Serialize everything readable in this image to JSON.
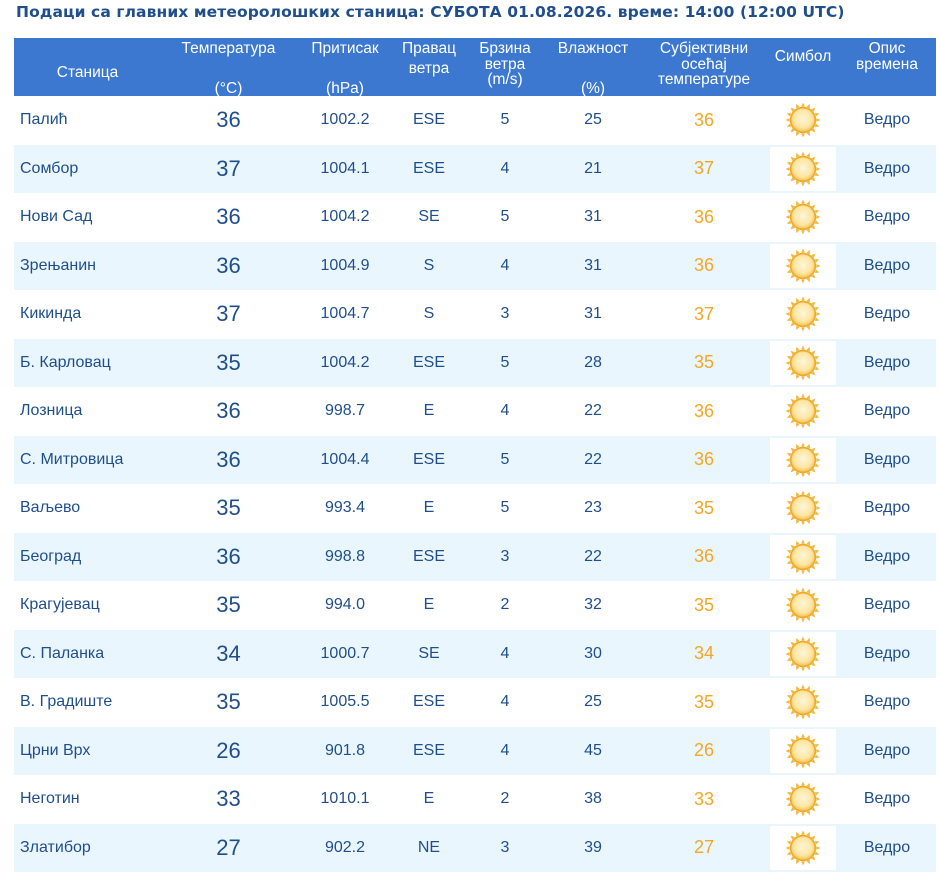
{
  "title": "Подаци са главних метеоролошких станица:  СУБОТА 01.08.2026.  време: 14:00 (12:00 UTC)",
  "headers": {
    "station": "Станица",
    "temperature": [
      "Температура",
      "(°C)"
    ],
    "pressure": [
      "Притисак",
      "(hPa)"
    ],
    "wind_dir": [
      "Правац",
      "ветра"
    ],
    "wind_speed": [
      "Брзина",
      "ветра",
      "(m/s)"
    ],
    "humidity": [
      "Влажност",
      "(%)"
    ],
    "feels_like": [
      "Субјективни",
      "осећај",
      "температуре"
    ],
    "symbol": "Симбол",
    "description": [
      "Опис",
      "времена"
    ]
  },
  "symbol_icon": "sun-icon",
  "colors": {
    "header_bg": "#3c78d0",
    "text": "#1f4e8c",
    "feels_like": "#f5a623",
    "row_alt": "#eaf6fd"
  },
  "rows": [
    {
      "station": "Палић",
      "temp": "36",
      "pressure": "1002.2",
      "dir": "ESE",
      "speed": "5",
      "humidity": "25",
      "feels": "36",
      "desc": "Ведро"
    },
    {
      "station": "Сомбор",
      "temp": "37",
      "pressure": "1004.1",
      "dir": "ESE",
      "speed": "4",
      "humidity": "21",
      "feels": "37",
      "desc": "Ведро"
    },
    {
      "station": "Нови Сад",
      "temp": "36",
      "pressure": "1004.2",
      "dir": "SE",
      "speed": "5",
      "humidity": "31",
      "feels": "36",
      "desc": "Ведро"
    },
    {
      "station": "Зрењанин",
      "temp": "36",
      "pressure": "1004.9",
      "dir": "S",
      "speed": "4",
      "humidity": "31",
      "feels": "36",
      "desc": "Ведро"
    },
    {
      "station": "Кикинда",
      "temp": "37",
      "pressure": "1004.7",
      "dir": "S",
      "speed": "3",
      "humidity": "31",
      "feels": "37",
      "desc": "Ведро"
    },
    {
      "station": "Б. Карловац",
      "temp": "35",
      "pressure": "1004.2",
      "dir": "ESE",
      "speed": "5",
      "humidity": "28",
      "feels": "35",
      "desc": "Ведро"
    },
    {
      "station": "Лозница",
      "temp": "36",
      "pressure": "998.7",
      "dir": "E",
      "speed": "4",
      "humidity": "22",
      "feels": "36",
      "desc": "Ведро"
    },
    {
      "station": "С. Митровица",
      "temp": "36",
      "pressure": "1004.4",
      "dir": "ESE",
      "speed": "5",
      "humidity": "22",
      "feels": "36",
      "desc": "Ведро"
    },
    {
      "station": "Ваљево",
      "temp": "35",
      "pressure": "993.4",
      "dir": "E",
      "speed": "5",
      "humidity": "23",
      "feels": "35",
      "desc": "Ведро"
    },
    {
      "station": "Београд",
      "temp": "36",
      "pressure": "998.8",
      "dir": "ESE",
      "speed": "3",
      "humidity": "22",
      "feels": "36",
      "desc": "Ведро"
    },
    {
      "station": "Крагујевац",
      "temp": "35",
      "pressure": "994.0",
      "dir": "E",
      "speed": "2",
      "humidity": "32",
      "feels": "35",
      "desc": "Ведро"
    },
    {
      "station": "С. Паланка",
      "temp": "34",
      "pressure": "1000.7",
      "dir": "SE",
      "speed": "4",
      "humidity": "30",
      "feels": "34",
      "desc": "Ведро"
    },
    {
      "station": "В. Градиште",
      "temp": "35",
      "pressure": "1005.5",
      "dir": "ESE",
      "speed": "4",
      "humidity": "25",
      "feels": "35",
      "desc": "Ведро"
    },
    {
      "station": "Црни Врх",
      "temp": "26",
      "pressure": "901.8",
      "dir": "ESE",
      "speed": "4",
      "humidity": "45",
      "feels": "26",
      "desc": "Ведро"
    },
    {
      "station": "Неготин",
      "temp": "33",
      "pressure": "1010.1",
      "dir": "E",
      "speed": "2",
      "humidity": "38",
      "feels": "33",
      "desc": "Ведро"
    },
    {
      "station": "Златибор",
      "temp": "27",
      "pressure": "902.2",
      "dir": "NE",
      "speed": "3",
      "humidity": "39",
      "feels": "27",
      "desc": "Ведро"
    }
  ]
}
